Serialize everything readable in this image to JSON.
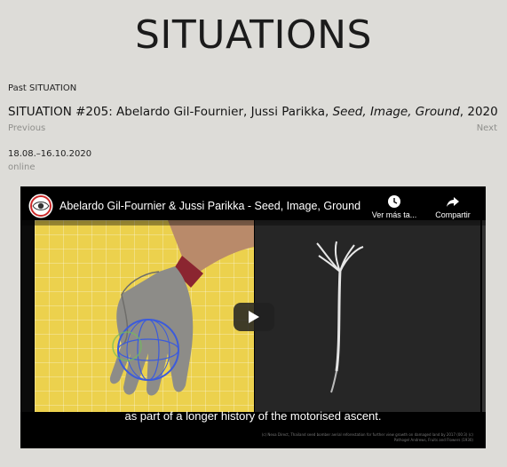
{
  "site": {
    "title": "SITUATIONS"
  },
  "breadcrumb": "Past SITUATION",
  "situation": {
    "prefix": "SITUATION #205: Abelardo Gil-Fournier, Jussi Parikka, ",
    "work_title": "Seed, Image, Ground",
    "year_sep": ", ",
    "year": "2020",
    "dates": "18.08.–16.10.2020",
    "location": "online"
  },
  "nav": {
    "previous": "Previous",
    "next": "Next"
  },
  "video": {
    "title": "Abelardo Gil-Fournier & Jussi Parikka - Seed, Image, Ground",
    "watch_later": "Ver más ta...",
    "share": "Compartir",
    "caption": "as part of a longer history of the motorised ascent.",
    "credit": "(c) Nexa Direct, Thailand seed bomber aerial reforestation for further view growth on damaged land by 2017 (00:3) (c) Pathogel Andrews, Fruits and Flowers (1930)",
    "icons": {
      "avatar": "channel-eye-logo-icon",
      "watch_later": "clock-icon",
      "share": "share-arrow-icon",
      "play": "play-icon"
    },
    "colors": {
      "frame_left": "#ecd14d",
      "accent_red": "#cc2a2a"
    }
  }
}
